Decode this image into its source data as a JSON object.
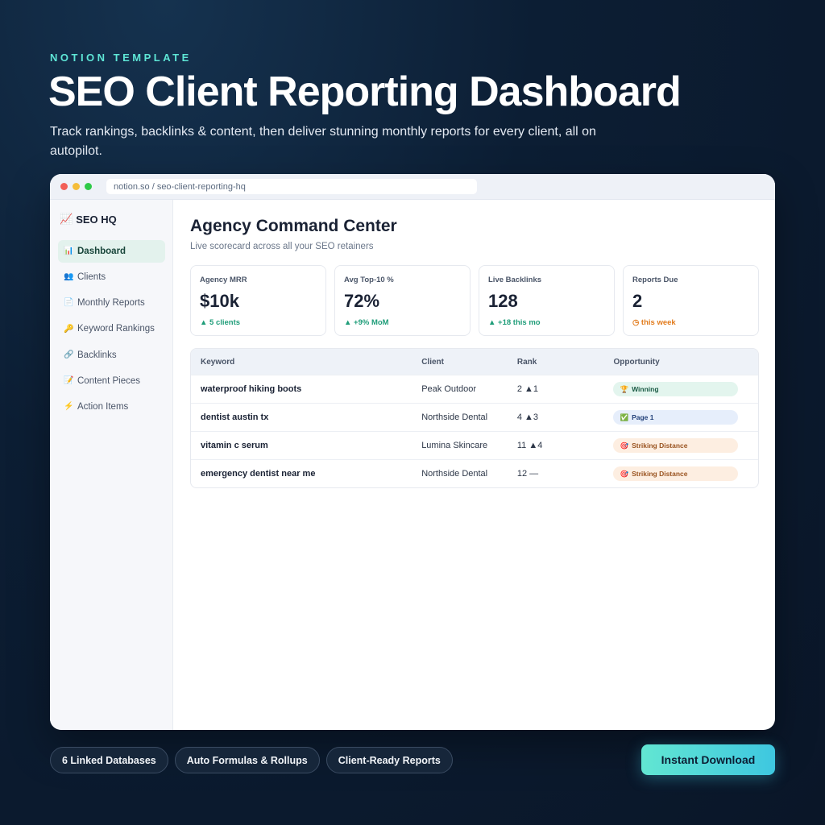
{
  "hero": {
    "eyebrow": "NOTION TEMPLATE",
    "title": "SEO Client Reporting Dashboard",
    "subtitle": "Track rankings, backlinks & content, then deliver stunning monthly reports for every client, all on autopilot."
  },
  "browser": {
    "url": "notion.so / seo-client-reporting-hq"
  },
  "sidebar": {
    "brand_icon": "📈",
    "brand": "SEO HQ",
    "items": [
      {
        "icon": "📊",
        "label": "Dashboard",
        "active": true
      },
      {
        "icon": "👥",
        "label": "Clients"
      },
      {
        "icon": "📄",
        "label": "Monthly Reports"
      },
      {
        "icon": "🔑",
        "label": "Keyword Rankings"
      },
      {
        "icon": "🔗",
        "label": "Backlinks"
      },
      {
        "icon": "📝",
        "label": "Content Pieces"
      },
      {
        "icon": "⚡",
        "label": "Action Items"
      }
    ]
  },
  "main": {
    "title": "Agency Command Center",
    "subtitle": "Live scorecard across all your SEO retainers"
  },
  "stats": [
    {
      "label": "Agency MRR",
      "value": "$10k",
      "delta": "▲ 5 clients",
      "tone": "up"
    },
    {
      "label": "Avg Top-10 %",
      "value": "72%",
      "delta": "▲ +9% MoM",
      "tone": "up"
    },
    {
      "label": "Live Backlinks",
      "value": "128",
      "delta": "▲ +18 this mo",
      "tone": "up"
    },
    {
      "label": "Reports Due",
      "value": "2",
      "delta": "◷ this week",
      "tone": "warn"
    }
  ],
  "table": {
    "headers": [
      "Keyword",
      "Client",
      "Rank",
      "Opportunity"
    ],
    "rows": [
      {
        "keyword": "waterproof hiking boots",
        "client": "Peak Outdoor",
        "rank": "2 ▲1",
        "opportunity": "Winning",
        "opp_icon": "🏆",
        "opp_type": "win"
      },
      {
        "keyword": "dentist austin tx",
        "client": "Northside Dental",
        "rank": "4 ▲3",
        "opportunity": "Page 1",
        "opp_icon": "✅",
        "opp_type": "page"
      },
      {
        "keyword": "vitamin c serum",
        "client": "Lumina Skincare",
        "rank": "11 ▲4",
        "opportunity": "Striking Distance",
        "opp_icon": "🎯",
        "opp_type": "strike"
      },
      {
        "keyword": "emergency dentist near me",
        "client": "Northside Dental",
        "rank": "12 —",
        "opportunity": "Striking Distance",
        "opp_icon": "🎯",
        "opp_type": "strike"
      }
    ]
  },
  "features": [
    "6 Linked Databases",
    "Auto Formulas & Rollups",
    "Client-Ready Reports"
  ],
  "cta": "Instant Download",
  "colors": {
    "accent": "#5ee6d6",
    "positive": "#1f9d79",
    "warning": "#e27c1e",
    "background": "#0c1e34"
  }
}
